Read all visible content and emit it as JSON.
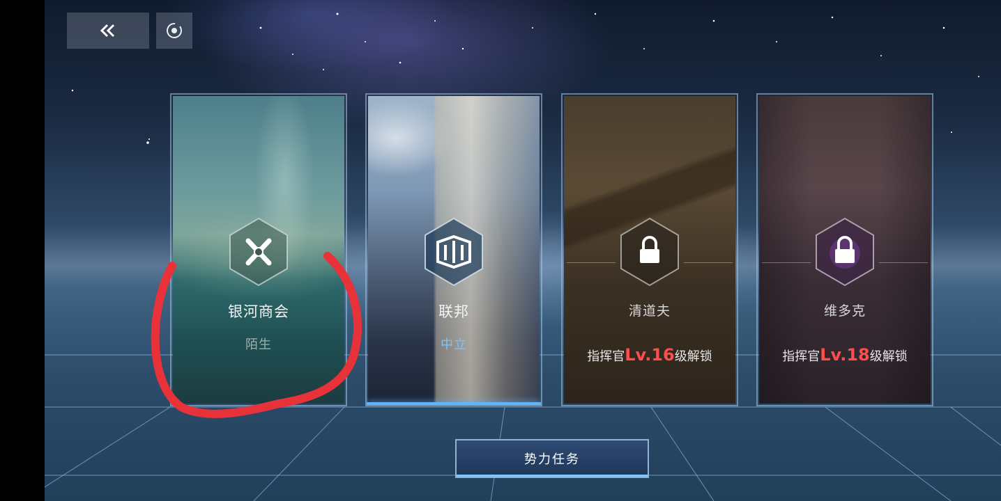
{
  "toolbar": {
    "back_icon": "double-chevron-left-icon",
    "target_icon": "target-circle-icon"
  },
  "factions": [
    {
      "name": "银河商会",
      "status": "陌生",
      "icon": "galactic-chamber-emblem-icon",
      "locked": false,
      "status_color": "#9fb0ae"
    },
    {
      "name": "联邦",
      "status": "中立",
      "icon": "federation-emblem-icon",
      "locked": false,
      "selected": true,
      "status_color": "#79c4ff"
    },
    {
      "name": "清道夫",
      "icon": "lock-icon",
      "locked": true,
      "unlock_prefix": "指挥官",
      "unlock_level": "Lv.16",
      "unlock_suffix": "级解锁"
    },
    {
      "name": "维多克",
      "icon": "lock-icon",
      "locked": true,
      "unlock_prefix": "指挥官",
      "unlock_level": "Lv.18",
      "unlock_suffix": "级解锁"
    }
  ],
  "task_button": {
    "label": "势力任务"
  },
  "colors": {
    "accent": "#5fb6ff",
    "level_red": "#ff4c4c",
    "annotation_red": "#e8323a"
  }
}
